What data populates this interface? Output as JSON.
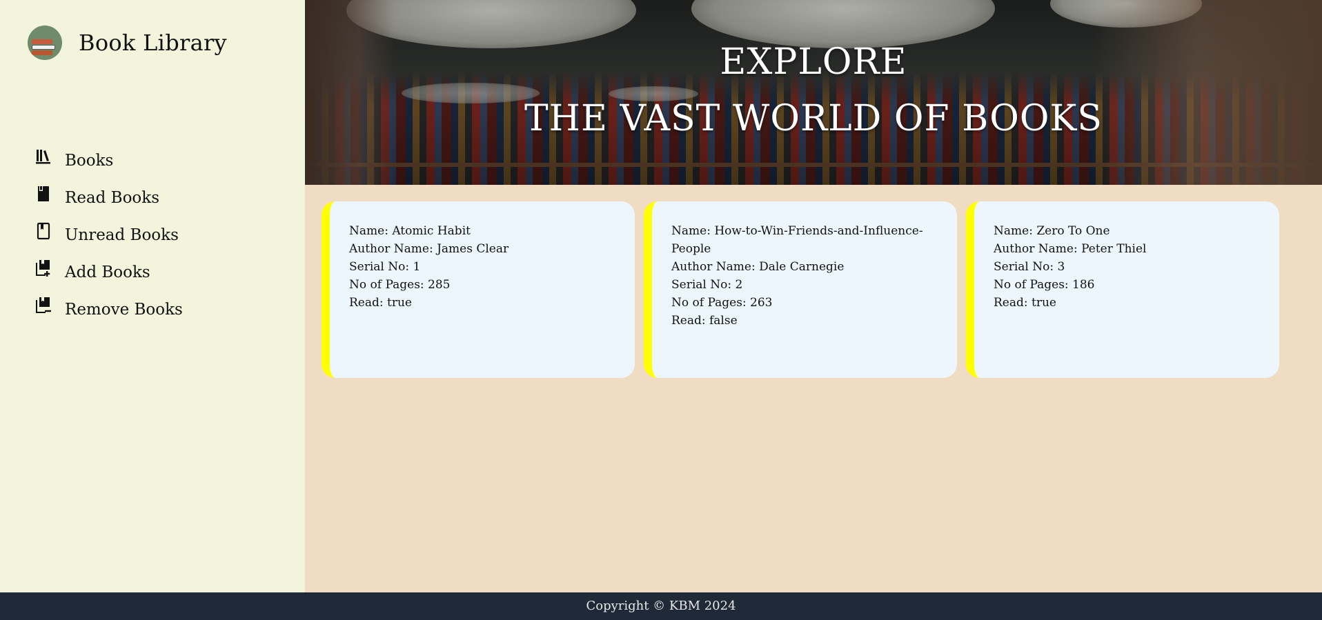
{
  "sidebar": {
    "brand_title": "Book Library",
    "logo_icon": "books-stack-icon",
    "items": [
      {
        "label": "Books",
        "icon": "library-icon"
      },
      {
        "label": "Read Books",
        "icon": "book-filled-icon"
      },
      {
        "label": "Unread Books",
        "icon": "book-outline-icon"
      },
      {
        "label": "Add Books",
        "icon": "book-add-icon"
      },
      {
        "label": "Remove Books",
        "icon": "book-remove-icon"
      }
    ]
  },
  "hero": {
    "line1": "EXPLORE",
    "line2": "THE VAST WORLD OF BOOKS"
  },
  "books": [
    {
      "name": "Name: Atomic Habit",
      "author": "Author Name: James Clear",
      "serial": "Serial No: 1",
      "pages": "No of Pages: 285",
      "read": "Read: true"
    },
    {
      "name": "Name: How-to-Win-Friends-and-Influence-People",
      "author": "Author Name: Dale Carnegie",
      "serial": "Serial No: 2",
      "pages": "No of Pages: 263",
      "read": "Read: false"
    },
    {
      "name": "Name: Zero To One",
      "author": "Author Name: Peter Thiel",
      "serial": "Serial No: 3",
      "pages": "No of Pages: 186",
      "read": "Read: true"
    }
  ],
  "footer": {
    "text": "Copyright © KBM 2024"
  },
  "colors": {
    "sidebar_bg": "#f3f4dc",
    "main_bg": "#efdcc2",
    "card_bg": "#edf6fd",
    "card_accent": "#ffff00",
    "footer_bg": "#1f2937"
  }
}
